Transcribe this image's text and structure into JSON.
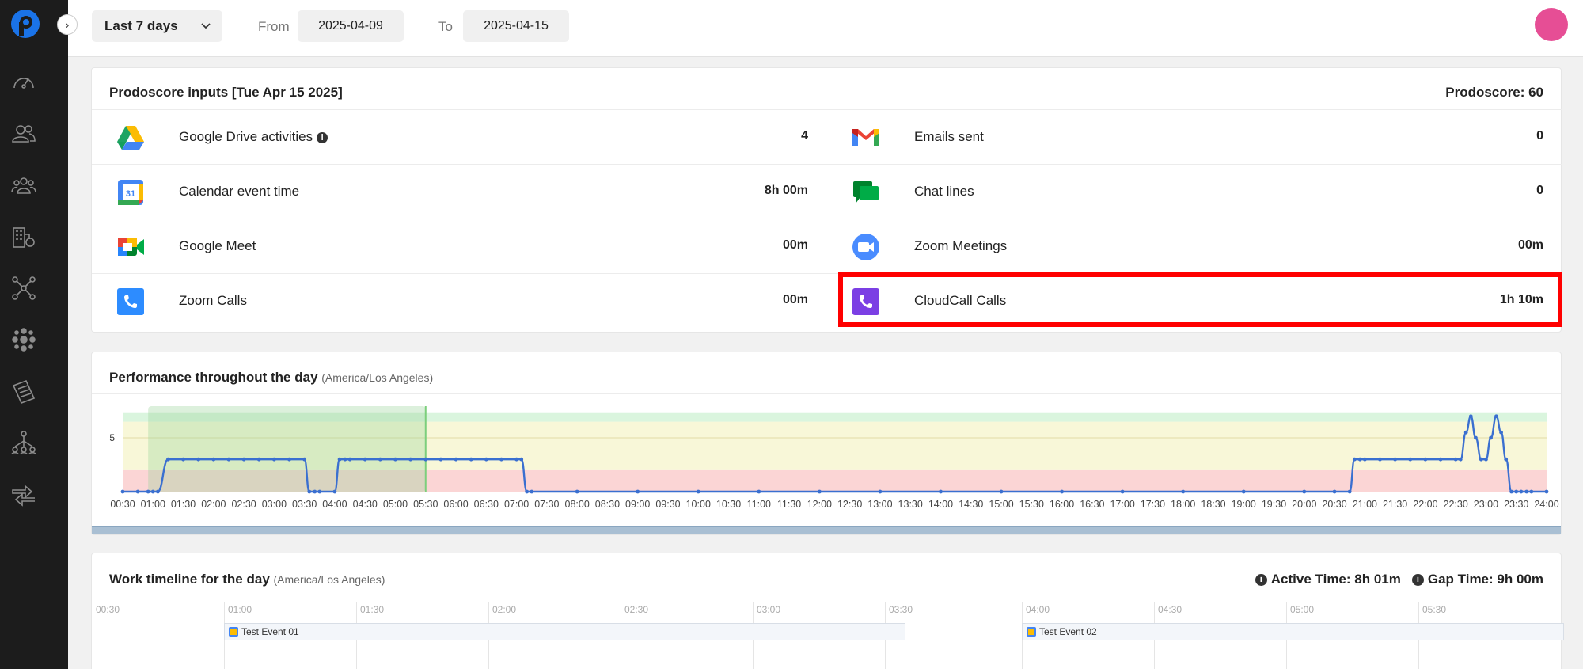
{
  "header": {
    "range_label": "Last 7 days",
    "from_label": "From",
    "from_date": "2025-04-09",
    "to_label": "To",
    "to_date": "2025-04-15"
  },
  "sidebar": {
    "items": [
      "speedometer-icon",
      "users-icon",
      "team-icon",
      "buildings-icon",
      "network-icon",
      "cluster-icon",
      "reports-icon",
      "org-chart-icon",
      "arrows-icon"
    ]
  },
  "inputs": {
    "title": "Prodoscore inputs [Tue Apr 15 2025]",
    "score_label": "Prodoscore: 60",
    "left": [
      {
        "label": "Google Drive activities",
        "value": "4",
        "icon": "google-drive-icon"
      },
      {
        "label": "Calendar event time",
        "value": "8h 00m",
        "icon": "google-calendar-icon"
      },
      {
        "label": "Google Meet",
        "value": "00m",
        "icon": "google-meet-icon"
      },
      {
        "label": "Zoom Calls",
        "value": "00m",
        "icon": "zoom-phone-icon"
      }
    ],
    "right": [
      {
        "label": "Emails sent",
        "value": "0",
        "icon": "gmail-icon"
      },
      {
        "label": "Chat lines",
        "value": "0",
        "icon": "google-chat-icon"
      },
      {
        "label": "Zoom Meetings",
        "value": "00m",
        "icon": "zoom-video-icon"
      },
      {
        "label": "CloudCall Calls",
        "value": "1h 10m",
        "icon": "cloudcall-icon"
      }
    ]
  },
  "performance": {
    "title": "Performance throughout the day",
    "timezone": "(America/Los Angeles)"
  },
  "chart_data": {
    "type": "line",
    "title": "Performance throughout the day",
    "ytick": "5",
    "xticks": [
      "00:30",
      "01:00",
      "01:30",
      "02:00",
      "02:30",
      "03:00",
      "03:30",
      "04:00",
      "04:30",
      "05:00",
      "05:30",
      "06:00",
      "06:30",
      "07:00",
      "07:30",
      "08:00",
      "08:30",
      "09:00",
      "09:30",
      "10:00",
      "10:30",
      "11:00",
      "11:30",
      "12:00",
      "12:30",
      "13:00",
      "13:30",
      "14:00",
      "14:30",
      "15:00",
      "15:30",
      "16:00",
      "16:30",
      "17:00",
      "17:30",
      "18:00",
      "18:30",
      "19:00",
      "19:30",
      "20:00",
      "20:30",
      "21:00",
      "21:30",
      "22:00",
      "22:30",
      "23:00",
      "23:30",
      "24:00"
    ],
    "x_hours": [
      0.5,
      0.75,
      0.92,
      1.0,
      1.08,
      1.25,
      1.5,
      1.75,
      2.0,
      2.25,
      2.5,
      2.75,
      3.0,
      3.25,
      3.5,
      3.58,
      3.67,
      3.75,
      4.0,
      4.08,
      4.17,
      4.25,
      4.5,
      4.75,
      5.0,
      5.25,
      5.5,
      5.75,
      6.0,
      6.25,
      6.5,
      6.75,
      7.0,
      7.08,
      7.17,
      7.25,
      8,
      9,
      10,
      11,
      12,
      13,
      14,
      15,
      16,
      17,
      18,
      19,
      20,
      20.5,
      20.75,
      20.83,
      20.92,
      21.0,
      21.25,
      21.5,
      21.75,
      22.0,
      22.25,
      22.5,
      22.58,
      22.67,
      22.75,
      22.83,
      22.92,
      23.0,
      23.08,
      23.17,
      23.25,
      23.33,
      23.42,
      23.5,
      23.58,
      23.67,
      23.75,
      24.0
    ],
    "values": [
      0,
      0,
      0,
      0,
      0,
      3,
      3,
      3,
      3,
      3,
      3,
      3,
      3,
      3,
      3,
      0,
      0,
      0,
      0,
      3,
      3,
      3,
      3,
      3,
      3,
      3,
      3,
      3,
      3,
      3,
      3,
      3,
      3,
      3,
      0,
      0,
      0,
      0,
      0,
      0,
      0,
      0,
      0,
      0,
      0,
      0,
      0,
      0,
      0,
      0,
      0,
      3,
      3,
      3,
      3,
      3,
      3,
      3,
      3,
      3,
      3,
      5.5,
      7,
      5,
      3,
      3,
      5,
      7,
      5.5,
      3,
      0,
      0,
      0,
      0,
      0,
      0
    ],
    "bands": {
      "red": [
        0,
        2
      ],
      "yellow": [
        2,
        6.5
      ],
      "green": [
        6.5,
        7.3
      ]
    },
    "ylim": [
      0,
      7.5
    ],
    "xlim": [
      0.5,
      24
    ],
    "highlight_range": [
      0.92,
      5.5
    ],
    "current_time": 5.5
  },
  "timeline": {
    "title": "Work timeline for the day",
    "timezone": "(America/Los Angeles)",
    "active_time": "Active Time: 8h 01m",
    "gap_time": "Gap Time: 9h 00m",
    "ticks": [
      "00:30",
      "01:00",
      "01:30",
      "02:00",
      "02:30",
      "03:00",
      "03:30",
      "04:00",
      "04:30",
      "05:00",
      "05:30"
    ],
    "events": [
      {
        "name": "Test Event 01"
      },
      {
        "name": "Test Event 02"
      }
    ]
  },
  "colors": {
    "sidebar_bg": "#1c1c1c",
    "brand_blue": "#1a73e8",
    "avatar": "#e64e95",
    "highlight": "#ff0000",
    "line": "#3a6fd0"
  }
}
